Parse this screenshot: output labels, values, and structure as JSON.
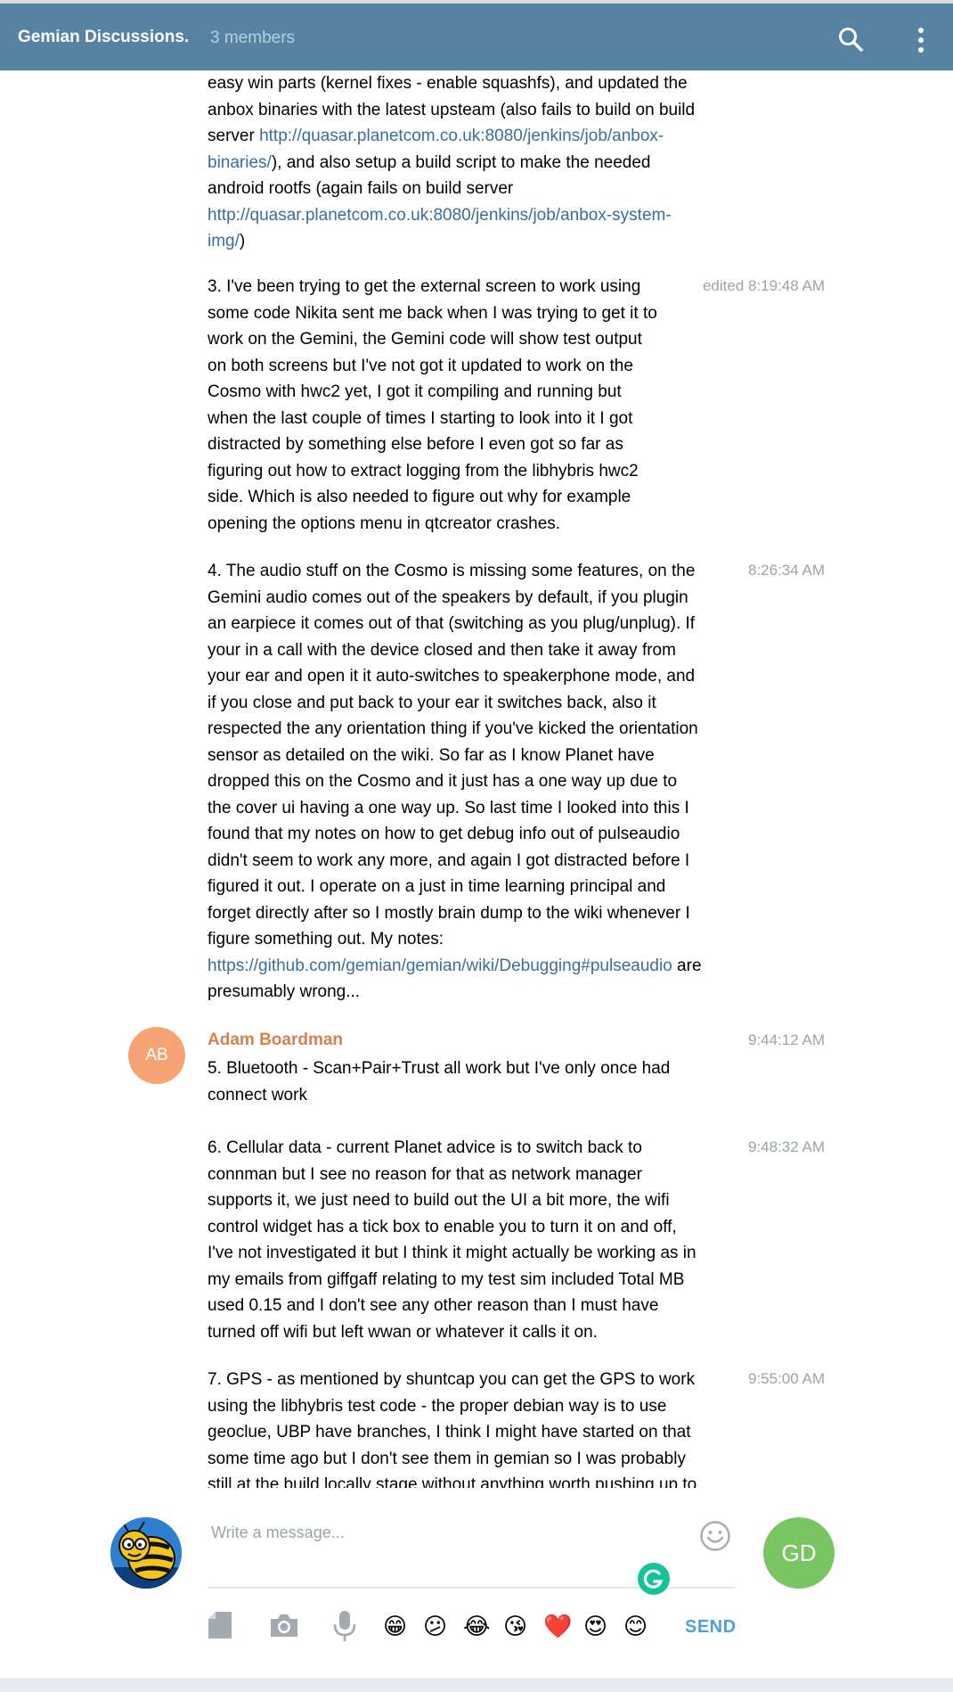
{
  "header": {
    "title": "Gemian Discussions.",
    "members": "3 members",
    "icons": [
      "search-icon",
      "more-vertical-icon"
    ]
  },
  "messages": {
    "m1": {
      "lines": [
        "easy win parts (kernel fixes - enable squashfs), and updated the",
        "anbox binaries with the latest upsteam (also fails to build on build"
      ],
      "l3_pre": "server ",
      "l3_link": "http://quasar.planetcom.co.uk:8080/jenkins/job/anbox-",
      "l4_link": "binaries/",
      "l4_post": "), and also setup a build script to make the needed",
      "l5": "android rootfs (again fails on build server",
      "l6_link": "http://quasar.planetcom.co.uk:8080/jenkins/job/anbox-system-",
      "l7_link": "img/",
      "l7_post": ")"
    },
    "m2": {
      "time": "edited 8:19:48 AM",
      "lines": [
        "3. I've been trying to get the external screen to work using",
        "some code Nikita sent me back when I was trying to get it to",
        "work on the Gemini, the Gemini code will show test output",
        "on both screens but I've not got it updated to work on the",
        "Cosmo with hwc2 yet, I got it compiling and running but",
        "when the last couple of times I starting to look into it I got",
        "distracted by something else before I even got so far as",
        "figuring out how to extract logging from the libhybris hwc2",
        "side. Which is also needed to figure out why for example",
        "opening the options menu in qtcreator crashes."
      ]
    },
    "m3": {
      "time": "8:26:34 AM",
      "lines": [
        "4. The audio stuff on the Cosmo is missing some features, on the",
        "Gemini audio comes out of the speakers by default, if you plugin",
        "an earpiece it comes out of that (switching as you plug/unplug). If",
        "your in a call with the device closed and then take it away from",
        "your ear and open it it auto-switches to speakerphone mode, and",
        "if you close and put back to your ear it switches back, also it",
        "respected the any orientation thing if you've kicked the orientation",
        "sensor as detailed on the wiki. So far as I know Planet have",
        "dropped this on the Cosmo and it just has a one way up due to",
        "the cover ui having a one way up. So last time I looked into this I",
        "found that my notes on how to get debug info out of pulseaudio",
        "didn't seem to work any more, and again I got distracted before I",
        "figured it out. I operate on a just in time learning principal and",
        "forget directly after so I mostly brain dump to the wiki whenever I",
        "figure something out. My notes:"
      ],
      "link": "https://github.com/gemian/gemian/wiki/Debugging#pulseaudio",
      "link_post": " are",
      "last": "presumably wrong..."
    },
    "m4": {
      "author": "Adam Boardman",
      "initials": "AB",
      "time": "9:44:12 AM",
      "lines": [
        "5. Bluetooth - Scan+Pair+Trust all work but I've only once had",
        "connect work"
      ]
    },
    "m5": {
      "time": "9:48:32 AM",
      "lines": [
        "6. Cellular data - current Planet advice is to switch back to",
        "connman but I see no reason for that as network manager",
        "supports it, we just need to build out the UI a bit more, the wifi",
        "control widget has a tick box to enable you to turn it on and off,",
        "I've not investigated it but I think it might actually be working as in",
        "my emails from giffgaff relating to my test sim included Total MB",
        "used 0.15 and I don't see any other reason than I must have",
        "turned off wifi but left wwan or whatever it calls it on."
      ]
    },
    "m6": {
      "time": "9:55:00 AM",
      "lines": [
        "7. GPS - as mentioned by shuntcap you can get the GPS to work",
        "using the libhybris test code - the proper debian way is to use",
        "geoclue, UBP have branches, I think I might have started on that",
        "some time ago but I don't see them in gemian so I was probably",
        "still at the build locally stage without anything worth pushing up to"
      ]
    }
  },
  "composer": {
    "placeholder": "Write a message...",
    "badge": "GD",
    "send_label": "SEND",
    "toolbar_icons": [
      "attach-file-icon",
      "camera-icon",
      "microphone-icon",
      "smile-icon"
    ],
    "emojis": [
      "😁",
      "😕",
      "😂",
      "😘",
      "❤️",
      "😍",
      "😊"
    ]
  },
  "colors": {
    "header": "#5682a3",
    "link": "#3a6d99",
    "author": "#d5804f",
    "author_avatar": "#f7a475",
    "badge": "#79c563",
    "send": "#4d9ee5"
  }
}
